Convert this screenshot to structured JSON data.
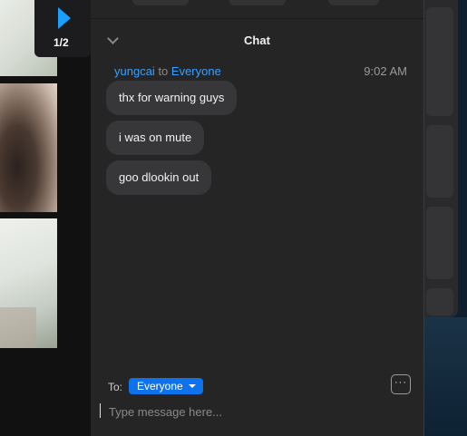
{
  "gallery": {
    "page_indicator": "1/2"
  },
  "chat": {
    "title": "Chat",
    "messages_group": {
      "sender": "yungcai",
      "to_word": "to",
      "recipient": "Everyone",
      "time": "9:02 AM",
      "messages": [
        "thx for warning guys",
        "i was on mute",
        "goo dlookin out"
      ]
    },
    "compose": {
      "to_label": "To:",
      "recipient": "Everyone",
      "more_label": "···",
      "placeholder": "Type message here..."
    }
  },
  "colors": {
    "accent": "#0e72ed",
    "link": "#3aa0ff",
    "panel": "#252526",
    "bubble": "#373739"
  },
  "icons": {
    "collapse": "chevron-down-icon",
    "pager": "play-arrow-icon",
    "dropdown": "caret-down-icon",
    "more": "ellipsis-icon"
  }
}
